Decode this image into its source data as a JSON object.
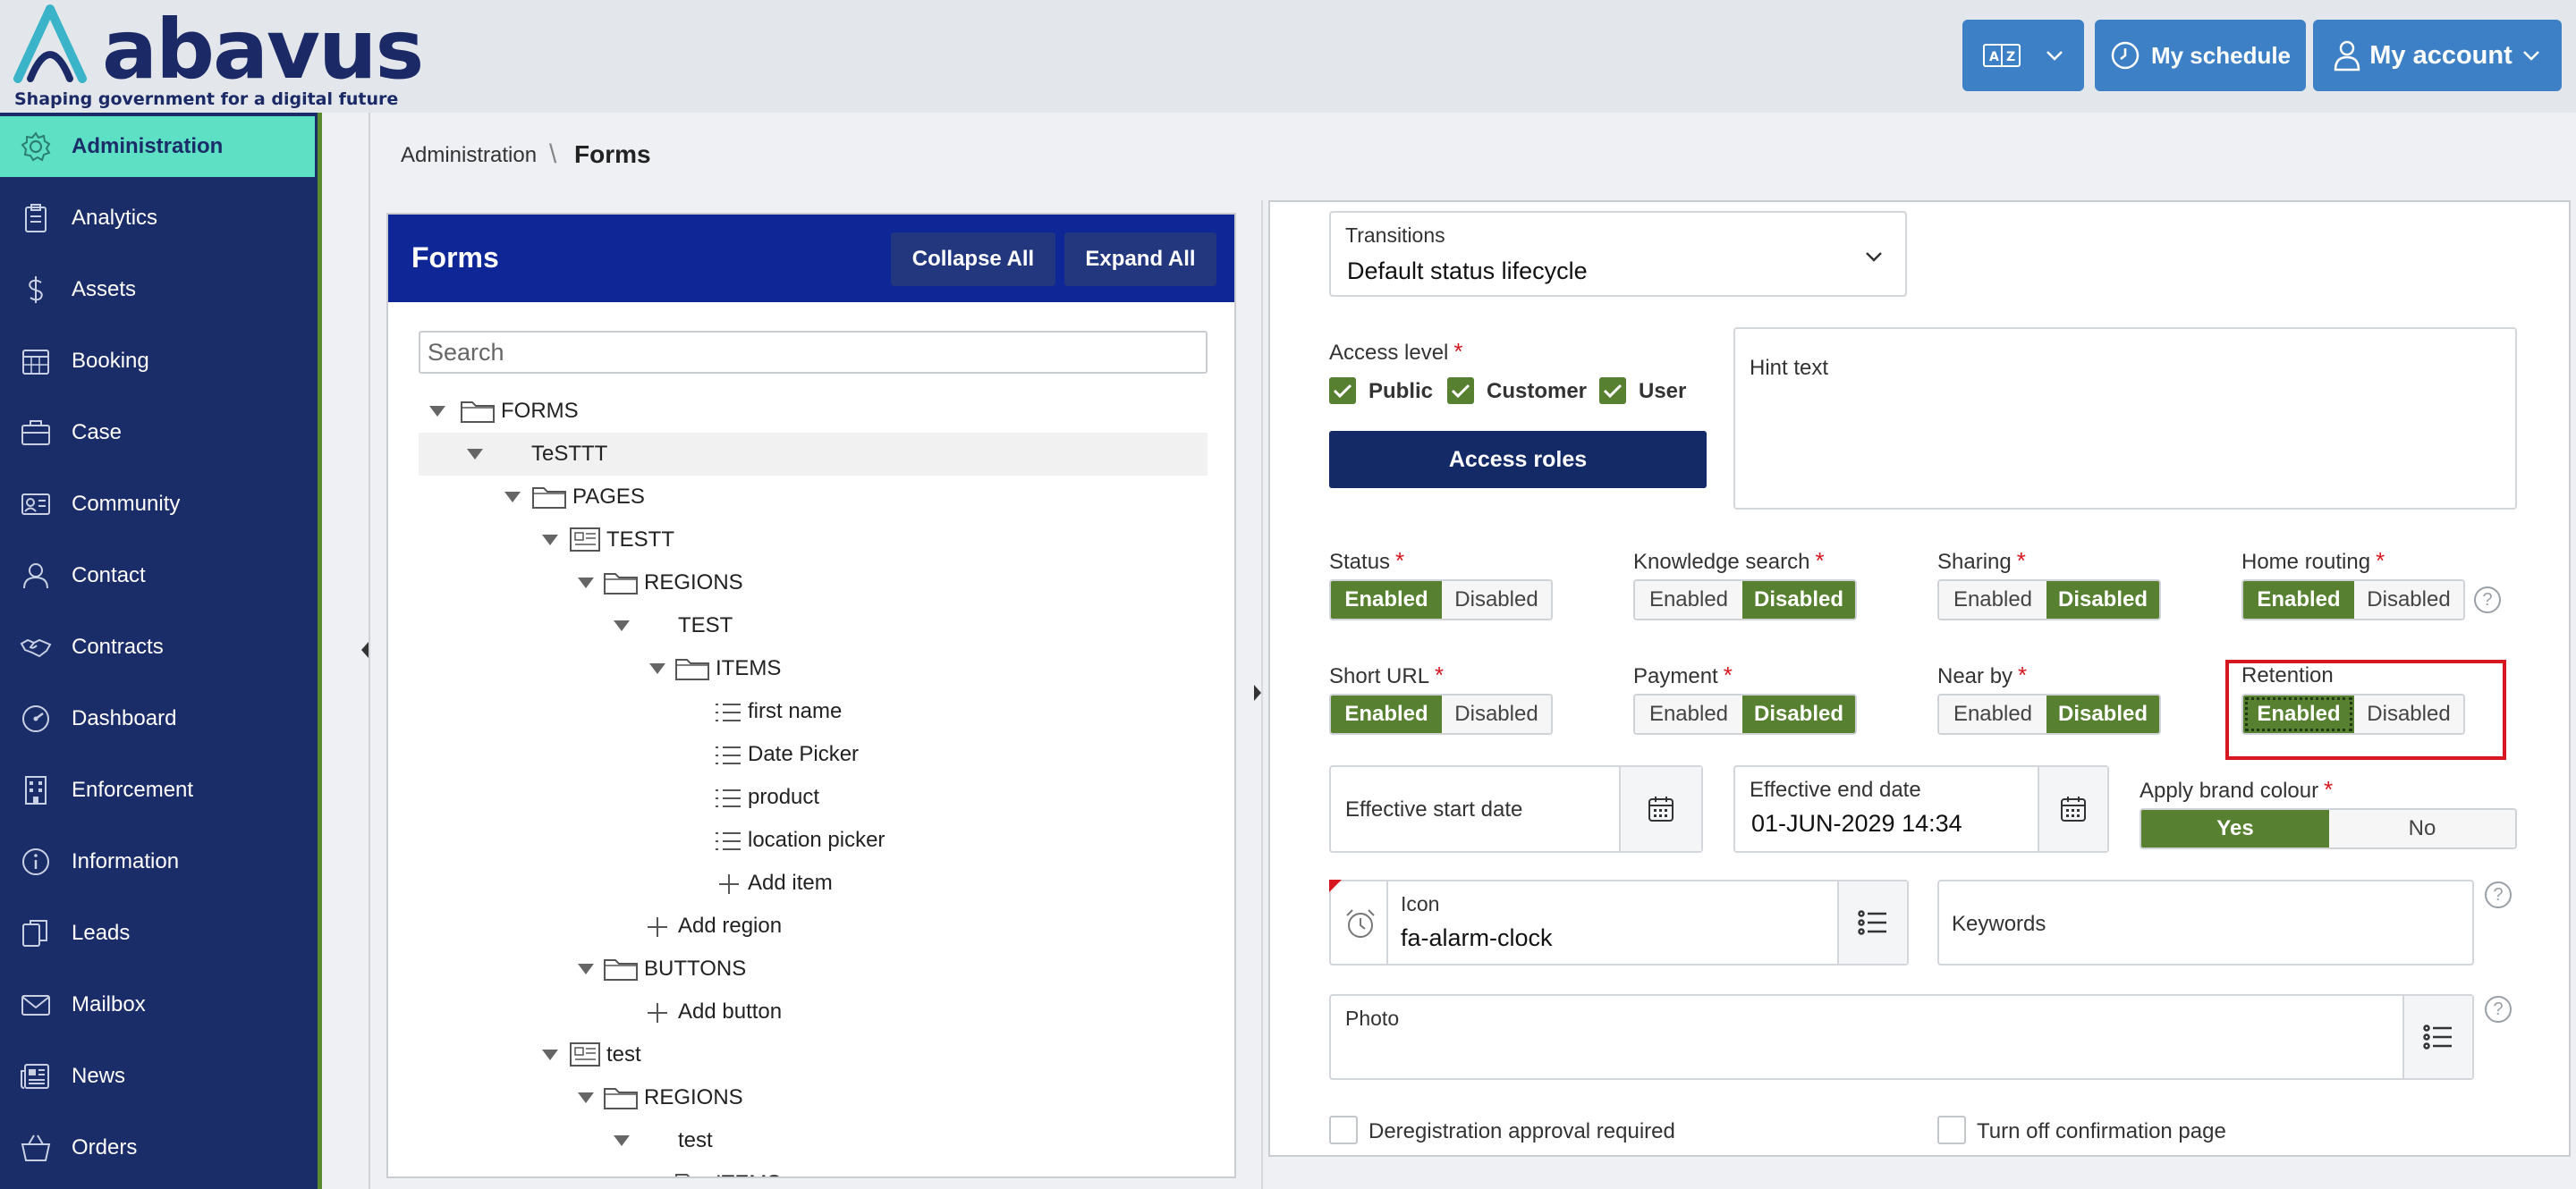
{
  "brand": {
    "name": "abavus",
    "tagline": "Shaping government for a digital future"
  },
  "header": {
    "translate_icon": "translate-icon",
    "schedule_label": "My schedule",
    "account_label": "My account"
  },
  "sidebar": {
    "items": [
      {
        "label": "Administration",
        "icon": "gear-icon"
      },
      {
        "label": "Analytics",
        "icon": "clipboard-icon"
      },
      {
        "label": "Assets",
        "icon": "dollar-icon"
      },
      {
        "label": "Booking",
        "icon": "calendar-icon"
      },
      {
        "label": "Case",
        "icon": "briefcase-icon"
      },
      {
        "label": "Community",
        "icon": "id-card-icon"
      },
      {
        "label": "Contact",
        "icon": "user-icon"
      },
      {
        "label": "Contracts",
        "icon": "handshake-icon"
      },
      {
        "label": "Dashboard",
        "icon": "gauge-icon"
      },
      {
        "label": "Enforcement",
        "icon": "building-icon"
      },
      {
        "label": "Information",
        "icon": "info-icon"
      },
      {
        "label": "Leads",
        "icon": "copy-icon"
      },
      {
        "label": "Mailbox",
        "icon": "envelope-icon"
      },
      {
        "label": "News",
        "icon": "newspaper-icon"
      },
      {
        "label": "Orders",
        "icon": "basket-icon"
      }
    ]
  },
  "breadcrumb": {
    "parent": "Administration",
    "separator": "\\",
    "current": "Forms"
  },
  "forms_panel": {
    "title": "Forms",
    "collapse_label": "Collapse All",
    "expand_label": "Expand All",
    "search_placeholder": "Search",
    "tree": [
      {
        "label": "FORMS",
        "icon": "folder-icon"
      },
      {
        "label": "TeSTTT",
        "icon": ""
      },
      {
        "label": "PAGES",
        "icon": "folder-icon"
      },
      {
        "label": "TESTT",
        "icon": "page-icon"
      },
      {
        "label": "REGIONS",
        "icon": "folder-icon"
      },
      {
        "label": "TEST",
        "icon": ""
      },
      {
        "label": "ITEMS",
        "icon": "folder-icon"
      },
      {
        "label": "first name",
        "icon": "list-icon"
      },
      {
        "label": "Date Picker",
        "icon": "list-icon"
      },
      {
        "label": "product",
        "icon": "list-icon"
      },
      {
        "label": "location picker",
        "icon": "list-icon"
      },
      {
        "label": "Add item",
        "icon": "plus-icon"
      },
      {
        "label": "Add region",
        "icon": "plus-icon"
      },
      {
        "label": "BUTTONS",
        "icon": "folder-icon"
      },
      {
        "label": "Add button",
        "icon": "plus-icon"
      },
      {
        "label": "test",
        "icon": "page-icon"
      },
      {
        "label": "REGIONS",
        "icon": "folder-icon"
      },
      {
        "label": "test",
        "icon": ""
      },
      {
        "label": "ITEMS",
        "icon": "folder-icon"
      }
    ]
  },
  "form": {
    "transitions": {
      "label": "Transitions",
      "value": "Default status lifecycle"
    },
    "access_level": {
      "label": "Access level",
      "options": [
        {
          "label": "Public",
          "checked": true
        },
        {
          "label": "Customer",
          "checked": true
        },
        {
          "label": "User",
          "checked": true
        }
      ]
    },
    "access_roles_label": "Access roles",
    "hint_text_placeholder": "Hint text",
    "toggles": [
      {
        "label": "Status",
        "required": true,
        "on": "Enabled",
        "off": "Disabled",
        "selected": "Enabled"
      },
      {
        "label": "Knowledge search",
        "required": true,
        "on": "Enabled",
        "off": "Disabled",
        "selected": "Disabled"
      },
      {
        "label": "Sharing",
        "required": true,
        "on": "Enabled",
        "off": "Disabled",
        "selected": "Disabled"
      },
      {
        "label": "Home routing",
        "required": true,
        "on": "Enabled",
        "off": "Disabled",
        "selected": "Enabled"
      },
      {
        "label": "Short URL",
        "required": true,
        "on": "Enabled",
        "off": "Disabled",
        "selected": "Enabled"
      },
      {
        "label": "Payment",
        "required": true,
        "on": "Enabled",
        "off": "Disabled",
        "selected": "Disabled"
      },
      {
        "label": "Near by",
        "required": true,
        "on": "Enabled",
        "off": "Disabled",
        "selected": "Disabled"
      },
      {
        "label": "Retention",
        "required": false,
        "on": "Enabled",
        "off": "Disabled",
        "selected": "Enabled"
      }
    ],
    "required_mark": "*",
    "effective_start": {
      "label": "Effective start date",
      "value": ""
    },
    "effective_end": {
      "label": "Effective end date",
      "value": "01-JUN-2029 14:34"
    },
    "brand_colour": {
      "label": "Apply brand colour",
      "yes": "Yes",
      "no": "No",
      "selected": "Yes"
    },
    "icon_field": {
      "label": "Icon",
      "value": "fa-alarm-clock"
    },
    "keywords_placeholder": "Keywords",
    "photo_label": "Photo",
    "help_mark": "?",
    "dereg_label": "Deregistration approval required",
    "confirm_label": "Turn off confirmation page"
  },
  "colors": {
    "sidebar": "#1b2d68",
    "active": "#5ee0c4",
    "accent_green": "#578130",
    "header_button": "#3d80c6",
    "forms_header": "#0f2796",
    "highlight_red": "#d6171f"
  }
}
